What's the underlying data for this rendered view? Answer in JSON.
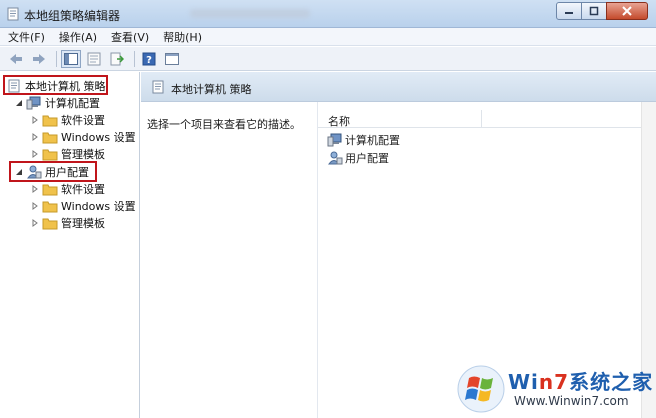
{
  "window": {
    "title": "本地组策略编辑器"
  },
  "menu": {
    "items": [
      {
        "label": "文件(F)"
      },
      {
        "label": "操作(A)"
      },
      {
        "label": "查看(V)"
      },
      {
        "label": "帮助(H)"
      }
    ]
  },
  "toolbar": {
    "icons": [
      "back-arrow-icon",
      "forward-arrow-icon",
      "show-hide-tree-icon",
      "properties-icon",
      "export-list-icon",
      "help-icon",
      "extended-view-icon"
    ]
  },
  "tree": {
    "root": {
      "label": "本地计算机 策略"
    },
    "computer": {
      "label": "计算机配置",
      "children": [
        {
          "label": "软件设置"
        },
        {
          "label": "Windows 设置"
        },
        {
          "label": "管理模板"
        }
      ]
    },
    "user": {
      "label": "用户配置",
      "children": [
        {
          "label": "软件设置"
        },
        {
          "label": "Windows 设置"
        },
        {
          "label": "管理模板"
        }
      ]
    }
  },
  "right": {
    "header_title": "本地计算机 策略",
    "description": "选择一个项目来查看它的描述。",
    "column_name": "名称",
    "items": [
      {
        "label": "计算机配置"
      },
      {
        "label": "用户配置"
      }
    ]
  },
  "watermark": {
    "brand_prefix": "Wi",
    "brand_seven": "n7",
    "brand_suffix": "系统之家",
    "url": "Www.Winwin7.com"
  },
  "colors": {
    "highlight_box": "#c0151b",
    "folder": "#f0c24b",
    "header_bg": "#cddceb"
  }
}
